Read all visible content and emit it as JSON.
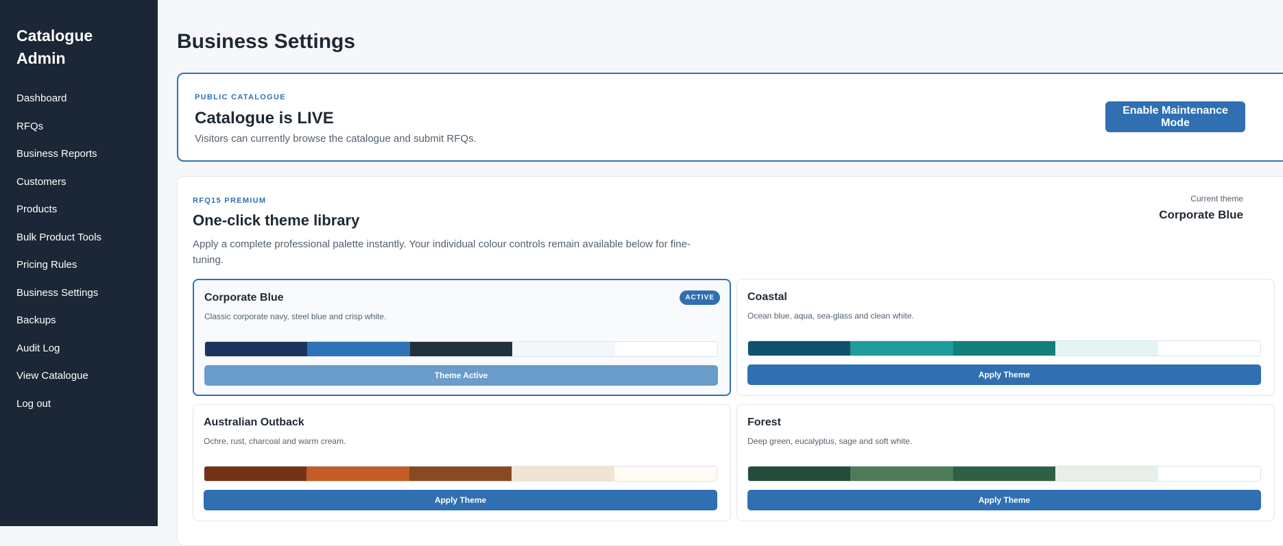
{
  "sidebar": {
    "brand": "Catalogue Admin",
    "items": [
      {
        "label": "Dashboard"
      },
      {
        "label": "RFQs"
      },
      {
        "label": "Business Reports"
      },
      {
        "label": "Customers"
      },
      {
        "label": "Products"
      },
      {
        "label": "Bulk Product Tools"
      },
      {
        "label": "Pricing Rules"
      },
      {
        "label": "Business Settings"
      },
      {
        "label": "Backups"
      },
      {
        "label": "Audit Log"
      },
      {
        "label": "View Catalogue"
      },
      {
        "label": "Log out"
      }
    ]
  },
  "page": {
    "title": "Business Settings"
  },
  "catalogue_status": {
    "eyebrow": "PUBLIC CATALOGUE",
    "title": "Catalogue is LIVE",
    "description": "Visitors can currently browse the catalogue and submit RFQs.",
    "button": "Enable Maintenance Mode"
  },
  "theme_library": {
    "eyebrow": "RFQ15 PREMIUM",
    "title": "One-click theme library",
    "description": "Apply a complete professional palette instantly. Your individual colour controls remain available below for fine-tuning.",
    "current_label": "Current theme",
    "current_value": "Corporate Blue",
    "themes": [
      {
        "name": "Corporate Blue",
        "description": "Classic corporate navy, steel blue and crisp white.",
        "badge": "ACTIVE",
        "button": "Theme Active",
        "colors": [
          "#1c355e",
          "#2e72b6",
          "#22323c",
          "#f3f6fa",
          "#ffffff"
        ]
      },
      {
        "name": "Coastal",
        "description": "Ocean blue, aqua, sea-glass and clean white.",
        "button": "Apply Theme",
        "colors": [
          "#0f5270",
          "#1f9b9e",
          "#14807b",
          "#e4f4f4",
          "#ffffff"
        ]
      },
      {
        "name": "Australian Outback",
        "description": "Ochre, rust, charcoal and warm cream.",
        "button": "Apply Theme",
        "colors": [
          "#733318",
          "#c45c26",
          "#874a22",
          "#f1e4d4",
          "#fffcf5"
        ]
      },
      {
        "name": "Forest",
        "description": "Deep green, eucalyptus, sage and soft white.",
        "button": "Apply Theme",
        "colors": [
          "#224d3b",
          "#4e7c5a",
          "#2f5f44",
          "#e8efe9",
          "#ffffff"
        ]
      }
    ]
  }
}
